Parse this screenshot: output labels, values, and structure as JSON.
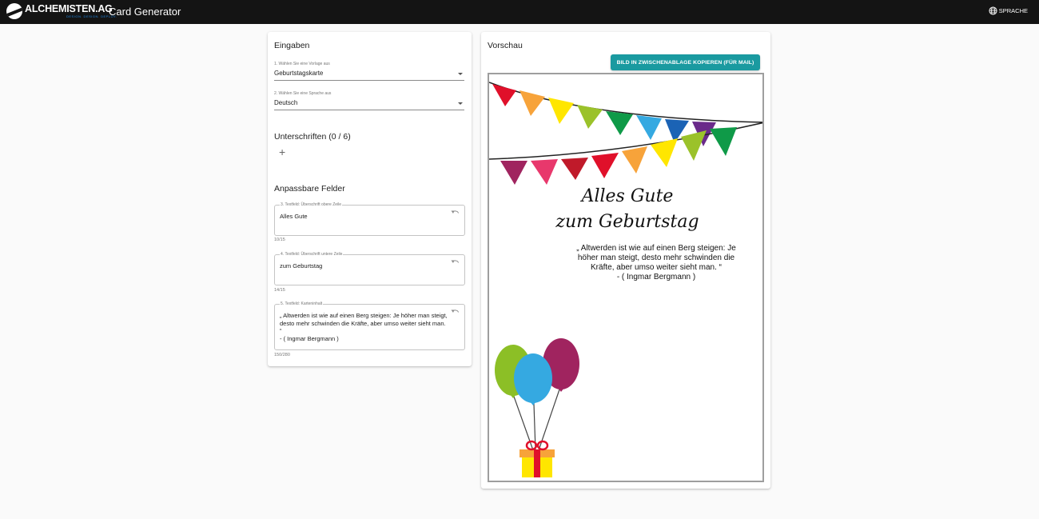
{
  "header": {
    "brand": "ALCHEMISTEN.AG",
    "brand_tagline": "DESIGN. DESIGN. DEPLOY.",
    "app_title": "Card Generator",
    "language_button": "SPRACHE"
  },
  "inputs": {
    "title": "Eingaben",
    "template_label": "1. Wählen Sie eine Vorlage aus",
    "template_value": "Geburtstagskarte",
    "language_label": "2. Wählen Sie eine Sprache aus",
    "language_value": "Deutsch"
  },
  "signatures": {
    "title": "Unterschriften (0 / 6)",
    "add_symbol": "+"
  },
  "fields": {
    "title": "Anpassbare Felder",
    "items": [
      {
        "label": "3. Textfeld: Überschrift obere Zeile",
        "value": "Alles Gute",
        "counter": "10/15"
      },
      {
        "label": "4. Textfeld: Überschrift untere Zeile",
        "value": "zum Geburtstag",
        "counter": "14/15"
      },
      {
        "label": "5. Textfeld: Karteninhalt",
        "value": "„ Altwerden ist wie auf einen Berg steigen: Je höher man steigt, desto mehr schwinden die Kräfte, aber umso weiter sieht man. “\n- ( Ingmar Bergmann )",
        "counter": "150/280"
      }
    ]
  },
  "preview": {
    "title": "Vorschau",
    "copy_button": "BILD IN ZWISCHENABLAGE KOPIEREN (FÜR MAIL)",
    "card_line1": "Alles Gute",
    "card_line2": "zum Geburtstag",
    "card_body": "„ Altwerden ist wie auf einen Berg steigen: Je höher man steigt, desto mehr schwinden die Kräfte, aber umso weiter sieht man. “\n- ( Ingmar Bergmann )"
  },
  "colors": {
    "topbar": "#141414",
    "accent_button": "#1a9aa0",
    "brand_blue": "#1e88e5"
  },
  "icons": [
    "logo-mark",
    "globe-icon",
    "chevron-down-icon",
    "plus-icon",
    "reset-icon",
    "balloon-icon",
    "gift-icon",
    "bunting-flag"
  ]
}
